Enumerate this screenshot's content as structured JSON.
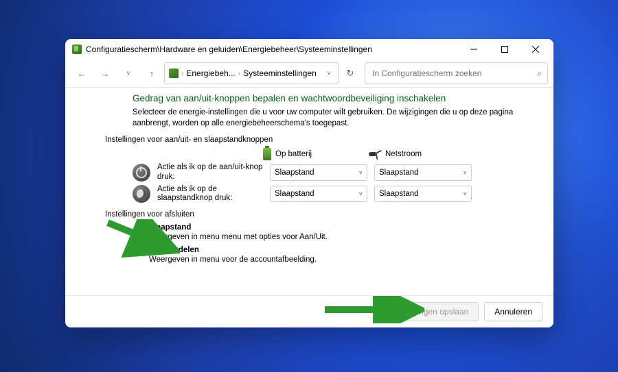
{
  "window": {
    "title": "Configuratiescherm\\Hardware en geluiden\\Energiebeheer\\Systeeminstellingen"
  },
  "nav": {
    "breadcrumb": {
      "seg1": "Energiebeh...",
      "seg2": "Systeeminstellingen"
    },
    "search_placeholder": "In Configuratiescherm zoeken"
  },
  "main": {
    "heading": "Gedrag van aan/uit-knoppen bepalen en wachtwoordbeveiliging inschakelen",
    "description": "Selecteer de energie-instellingen die u voor uw computer wilt gebruiken. De wijzigingen die u op deze pagina aanbrengt, worden op alle energiebeheerschema's toegepast.",
    "section1_label": "Instellingen voor aan/uit- en slaapstandknoppen",
    "col_battery": "Op batterij",
    "col_plugged": "Netstroom",
    "row1_label": "Actie als ik op de aan/uit-knop druk:",
    "row2_label": "Actie als ik op de slaapstandknop druk:",
    "dropdown_value": "Slaapstand",
    "section2_label": "Instellingen voor afsluiten",
    "chk1_label": "Slaapstand",
    "chk1_desc": "Weergeven in menu menu met opties voor Aan/Uit.",
    "chk2_label": "Vergrendelen",
    "chk2_desc": "Weergeven in menu voor de accountafbeelding."
  },
  "footer": {
    "save": "Wijzigingen opslaan",
    "cancel": "Annuleren"
  }
}
